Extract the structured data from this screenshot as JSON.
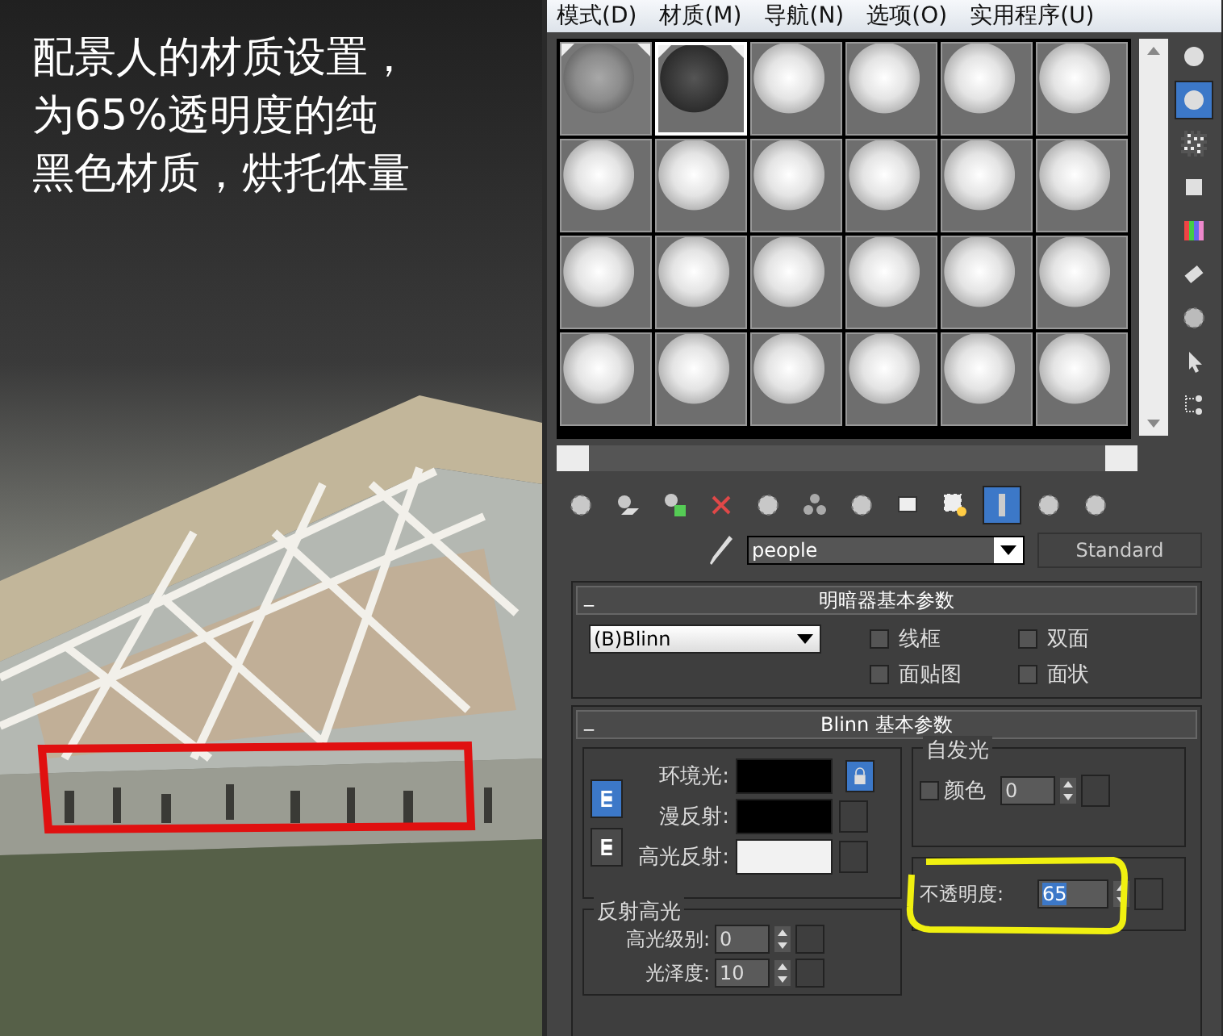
{
  "caption": [
    "配景人的材质设置，",
    "为65%透明度的纯",
    "黑色材质，烘托体量"
  ],
  "menu": [
    {
      "label": "模式(D)"
    },
    {
      "label": "材质(M)"
    },
    {
      "label": "导航(N)"
    },
    {
      "label": "选项(O)"
    },
    {
      "label": "实用程序(U)"
    }
  ],
  "sample_slots": [
    {
      "kind": "gray",
      "selected": false,
      "hot": true
    },
    {
      "kind": "black",
      "selected": true,
      "hot": true
    },
    {
      "kind": "white",
      "selected": false,
      "hot": false
    },
    {
      "kind": "white",
      "selected": false,
      "hot": false
    },
    {
      "kind": "white",
      "selected": false,
      "hot": false
    },
    {
      "kind": "white",
      "selected": false,
      "hot": false
    },
    {
      "kind": "white",
      "selected": false,
      "hot": false
    },
    {
      "kind": "white",
      "selected": false,
      "hot": false
    },
    {
      "kind": "white",
      "selected": false,
      "hot": false
    },
    {
      "kind": "white",
      "selected": false,
      "hot": false
    },
    {
      "kind": "white",
      "selected": false,
      "hot": false
    },
    {
      "kind": "white",
      "selected": false,
      "hot": false
    },
    {
      "kind": "white",
      "selected": false,
      "hot": false
    },
    {
      "kind": "white",
      "selected": false,
      "hot": false
    },
    {
      "kind": "white",
      "selected": false,
      "hot": false
    },
    {
      "kind": "white",
      "selected": false,
      "hot": false
    },
    {
      "kind": "white",
      "selected": false,
      "hot": false
    },
    {
      "kind": "white",
      "selected": false,
      "hot": false
    },
    {
      "kind": "white",
      "selected": false,
      "hot": false
    },
    {
      "kind": "white",
      "selected": false,
      "hot": false
    },
    {
      "kind": "white",
      "selected": false,
      "hot": false
    },
    {
      "kind": "white",
      "selected": false,
      "hot": false
    },
    {
      "kind": "white",
      "selected": false,
      "hot": false
    },
    {
      "kind": "white",
      "selected": false,
      "hot": false
    }
  ],
  "side_tools": [
    {
      "selected": false
    },
    {
      "selected": true
    },
    {
      "selected": false
    },
    {
      "selected": false
    },
    {
      "selected": false
    },
    {
      "selected": false
    },
    {
      "selected": false
    },
    {
      "selected": false
    },
    {
      "selected": false
    }
  ],
  "toolbar": [
    {
      "selected": false
    },
    {
      "selected": false
    },
    {
      "selected": false
    },
    {
      "selected": false
    },
    {
      "selected": false
    },
    {
      "selected": false
    },
    {
      "selected": false
    },
    {
      "selected": false
    },
    {
      "selected": false
    },
    {
      "selected": true
    },
    {
      "selected": false
    },
    {
      "selected": false
    }
  ],
  "material_name": "people",
  "material_type": "Standard",
  "shader_rollout": {
    "toggle": "_",
    "title": "明暗器基本参数",
    "shader": "(B)Blinn",
    "options": [
      {
        "label": "线框",
        "checked": false
      },
      {
        "label": "双面",
        "checked": false
      },
      {
        "label": "面贴图",
        "checked": false
      },
      {
        "label": "面状",
        "checked": false
      }
    ]
  },
  "blinn_rollout": {
    "toggle": "_",
    "title": "Blinn 基本参数",
    "colors": [
      {
        "label": "环境光:",
        "color": "#000000"
      },
      {
        "label": "漫反射:",
        "color": "#000000"
      },
      {
        "label": "高光反射:",
        "color": "#f2f2f2"
      }
    ],
    "lock_buttons": [
      {
        "selected": true
      },
      {
        "selected": false
      }
    ],
    "color_lock": true,
    "self_illum": {
      "title": "自发光",
      "label": "颜色",
      "checked": false,
      "value": "0"
    },
    "opacity": {
      "label": "不透明度:",
      "value": "65",
      "highlighted": true
    },
    "specular": {
      "title": "反射高光",
      "rows": [
        {
          "label": "高光级别:",
          "value": "0"
        },
        {
          "label": "光泽度:",
          "value": "10"
        }
      ]
    }
  }
}
